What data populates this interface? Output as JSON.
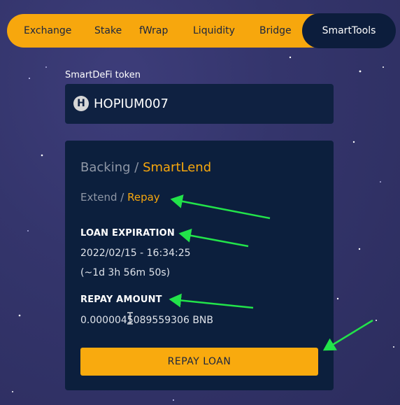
{
  "nav": {
    "items": [
      {
        "label": "Exchange"
      },
      {
        "label": "Stake"
      },
      {
        "label": "fWrap"
      },
      {
        "label": "Liquidity"
      },
      {
        "label": "Bridge"
      },
      {
        "label": "SmartTools",
        "active": true
      }
    ]
  },
  "token": {
    "label": "SmartDeFi token",
    "icon_letter": "H",
    "name": "HOPIUM007"
  },
  "card": {
    "breadcrumb": {
      "parent": "Backing",
      "separator": " / ",
      "current": "SmartLend"
    },
    "subnav": {
      "extend": "Extend",
      "separator": " / ",
      "repay": "Repay"
    },
    "loan_expiration": {
      "heading": "LOAN EXPIRATION",
      "datetime": "2022/02/15 - 16:34:25",
      "remaining": "(~1d 3h 56m 50s)"
    },
    "repay_amount": {
      "heading": "REPAY AMOUNT",
      "value": "0.0000045089559306 BNB"
    },
    "button_label": "REPAY LOAN"
  },
  "colors": {
    "accent": "#f7a70d",
    "card": "#0c1f3d",
    "background": "#34356c",
    "annotation_arrow": "#22e34a"
  }
}
